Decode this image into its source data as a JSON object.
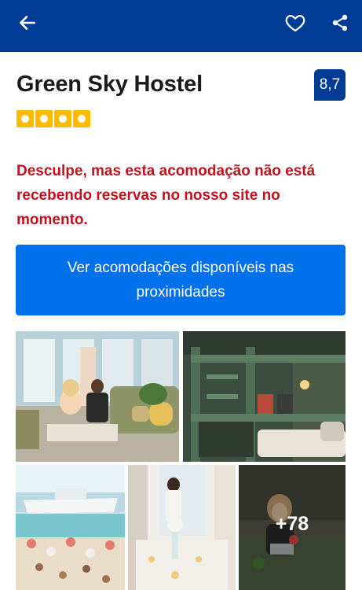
{
  "header": {
    "back_icon": "arrow-left-icon",
    "favorite_icon": "heart-icon",
    "share_icon": "share-icon",
    "background": "#003b95"
  },
  "property": {
    "name": "Green Sky Hostel",
    "score": "8,7",
    "stars": 4
  },
  "notice": {
    "message": "Desculpe, mas esta acomodação não está recebendo reservas no nosso site no momento.",
    "color": "#c1121f"
  },
  "cta": {
    "label": "Ver acomodações disponíveis nas proximidades",
    "color": "#0071eb"
  },
  "gallery": {
    "more_count": "+78"
  }
}
